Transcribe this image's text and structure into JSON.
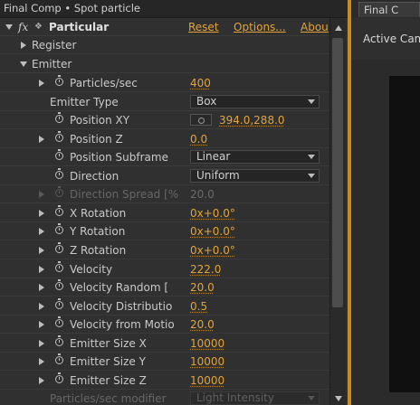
{
  "effect_controls": {
    "header_title": "Final Comp • Spot particle",
    "effect_name": "Particular",
    "fx_label": "fx",
    "reset_label": "Reset",
    "options_label": "Options...",
    "about_label": "Abou",
    "register_label": "Register",
    "emitter_label": "Emitter",
    "params": {
      "particles_sec": {
        "label": "Particles/sec",
        "value": "400"
      },
      "emitter_type": {
        "label": "Emitter Type",
        "value": "Box"
      },
      "position_xy": {
        "label": "Position XY",
        "value": "394.0,288.0"
      },
      "position_z": {
        "label": "Position Z",
        "value": "0.0"
      },
      "position_subframe": {
        "label": "Position Subframe",
        "value": "Linear"
      },
      "direction": {
        "label": "Direction",
        "value": "Uniform"
      },
      "direction_spread": {
        "label": "Direction Spread [%",
        "value": "20.0"
      },
      "x_rotation": {
        "label": "X Rotation",
        "value": "0x+0.0°"
      },
      "y_rotation": {
        "label": "Y Rotation",
        "value": "0x+0.0°"
      },
      "z_rotation": {
        "label": "Z Rotation",
        "value": "0x+0.0°"
      },
      "velocity": {
        "label": "Velocity",
        "value": "222.0"
      },
      "velocity_random": {
        "label": "Velocity Random [",
        "value": "20.0"
      },
      "velocity_distribution": {
        "label": "Velocity Distributio",
        "value": "0.5"
      },
      "velocity_from_motion": {
        "label": "Velocity from Motio",
        "value": "20.0"
      },
      "emitter_size_x": {
        "label": "Emitter Size X",
        "value": "10000"
      },
      "emitter_size_y": {
        "label": "Emitter Size Y",
        "value": "10000"
      },
      "emitter_size_z": {
        "label": "Emitter Size Z",
        "value": "10000"
      },
      "particles_sec_modifier": {
        "label": "Particles/sec modifier",
        "value": "Light Intensity"
      }
    }
  },
  "composition": {
    "tab_label": "Final C",
    "active_camera_label": "Active Cam"
  },
  "colors": {
    "value_orange": "#e2a43a",
    "panel_bg": "#303030",
    "divider": "#c78a2a"
  }
}
